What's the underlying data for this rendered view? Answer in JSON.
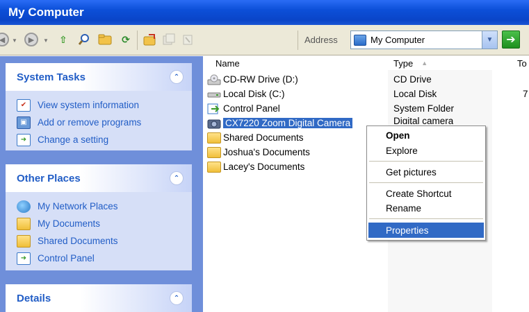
{
  "window": {
    "title": "My Computer"
  },
  "toolbar": {
    "icons": [
      "back-icon",
      "forward-icon",
      "up-icon",
      "search-icon",
      "folders-icon",
      "refresh-icon",
      "move-to-icon",
      "copy-to-icon",
      "delete-icon"
    ],
    "address_label": "Address",
    "address_value": "My Computer",
    "go_icon": "go-arrow-icon"
  },
  "left_pane": {
    "system_tasks": {
      "title": "System Tasks",
      "items": [
        {
          "label": "View system information",
          "icon": "system-info-icon"
        },
        {
          "label": "Add or remove programs",
          "icon": "add-remove-icon"
        },
        {
          "label": "Change a setting",
          "icon": "control-panel-icon"
        }
      ]
    },
    "other_places": {
      "title": "Other Places",
      "items": [
        {
          "label": "My Network Places",
          "icon": "network-places-icon"
        },
        {
          "label": "My Documents",
          "icon": "my-documents-icon"
        },
        {
          "label": "Shared Documents",
          "icon": "shared-folder-icon"
        },
        {
          "label": "Control Panel",
          "icon": "control-panel-icon"
        }
      ]
    },
    "details": {
      "title": "Details"
    }
  },
  "file_list": {
    "columns": {
      "name": "Name",
      "type": "Type",
      "total": "To"
    },
    "rows": [
      {
        "name": "CD-RW Drive (D:)",
        "type": "CD Drive",
        "icon": "cd-drive-icon"
      },
      {
        "name": "Local Disk (C:)",
        "type": "Local Disk",
        "icon": "hard-disk-icon"
      },
      {
        "name": "Control Panel",
        "type": "System Folder",
        "icon": "control-panel-icon"
      },
      {
        "name": "CX7220 Zoom Digital Camera",
        "type": "Digital camera",
        "icon": "camera-icon",
        "selected": true
      },
      {
        "name": "Shared Documents",
        "type": "",
        "icon": "folder-icon"
      },
      {
        "name": "Joshua's Documents",
        "type": "",
        "icon": "folder-icon"
      },
      {
        "name": "Lacey's Documents",
        "type": "",
        "icon": "folder-icon"
      }
    ],
    "truncated_total": "7"
  },
  "context_menu": {
    "items": [
      {
        "label": "Open",
        "bold": true
      },
      {
        "label": "Explore"
      },
      {
        "label": "Get pictures"
      },
      {
        "label": "Create Shortcut"
      },
      {
        "label": "Rename"
      },
      {
        "label": "Properties",
        "highlighted": true
      }
    ]
  }
}
